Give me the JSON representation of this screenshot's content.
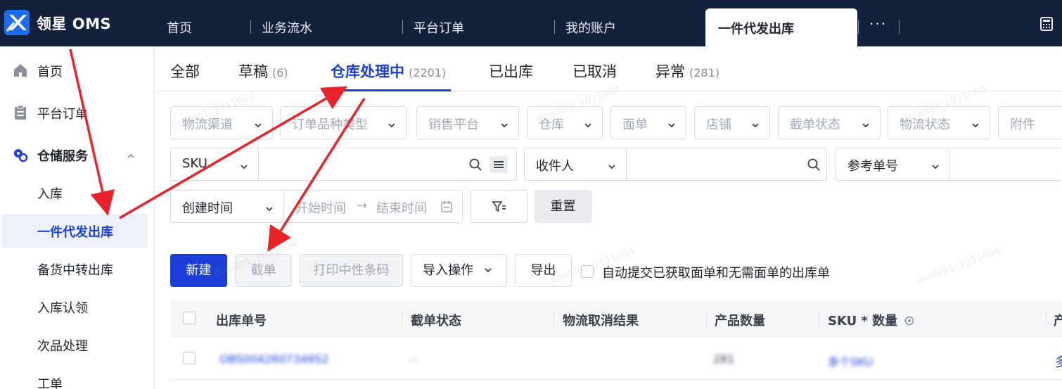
{
  "app": {
    "logo_text": "领星 OMS",
    "accent": "#1b3ed6",
    "topbar_bg": "#14213d"
  },
  "top_tabs": [
    {
      "label": "首页"
    },
    {
      "label": "业务流水"
    },
    {
      "label": "平台订单"
    },
    {
      "label": "我的账户"
    }
  ],
  "active_top_tab": "一件代发出库",
  "top_more": "···",
  "sidebar": {
    "home": "首页",
    "platform_orders": "平台订单",
    "warehouse_group": "仓储服务",
    "sub_items": [
      {
        "label": "入库"
      },
      {
        "label": "一件代发出库",
        "active": true
      },
      {
        "label": "备货中转出库"
      },
      {
        "label": "入库认领"
      },
      {
        "label": "次品处理"
      },
      {
        "label": "工单"
      }
    ]
  },
  "status_tabs": [
    {
      "label": "全部",
      "count": ""
    },
    {
      "label": "草稿",
      "count": "(6)"
    },
    {
      "label": "仓库处理中",
      "count": "(2201)",
      "active": true
    },
    {
      "label": "已出库",
      "count": ""
    },
    {
      "label": "已取消",
      "count": ""
    },
    {
      "label": "异常",
      "count": "(281)"
    }
  ],
  "filters": {
    "row1": [
      "物流渠道",
      "订单品种类型",
      "销售平台",
      "仓库",
      "面单",
      "店铺",
      "截单状态",
      "物流状态",
      "附件"
    ],
    "sku_select": "SKU",
    "recipient_select": "收件人",
    "reference_select": "参考单号",
    "date_select": "创建时间",
    "start_time": "开始时间",
    "end_time": "结束时间",
    "date_arrow": "→",
    "reset": "重置"
  },
  "actions": {
    "new": "新建",
    "cutoff": "截单",
    "print_neutral": "打印中性条码",
    "import": "导入操作",
    "export": "导出",
    "auto_submit": "自动提交已获取面单和无需面单的出库单"
  },
  "table": {
    "columns": [
      "出库单号",
      "截单状态",
      "物流取消结果",
      "产品数量",
      "SKU * 数量"
    ],
    "last_column_partial": "产",
    "rows": [
      {
        "order_no": "OBS0042607346S2",
        "cutoff": "--",
        "qty": "281",
        "sku": "多个SKU",
        "last": "多"
      }
    ]
  },
  "watermark": "double1_1011004"
}
